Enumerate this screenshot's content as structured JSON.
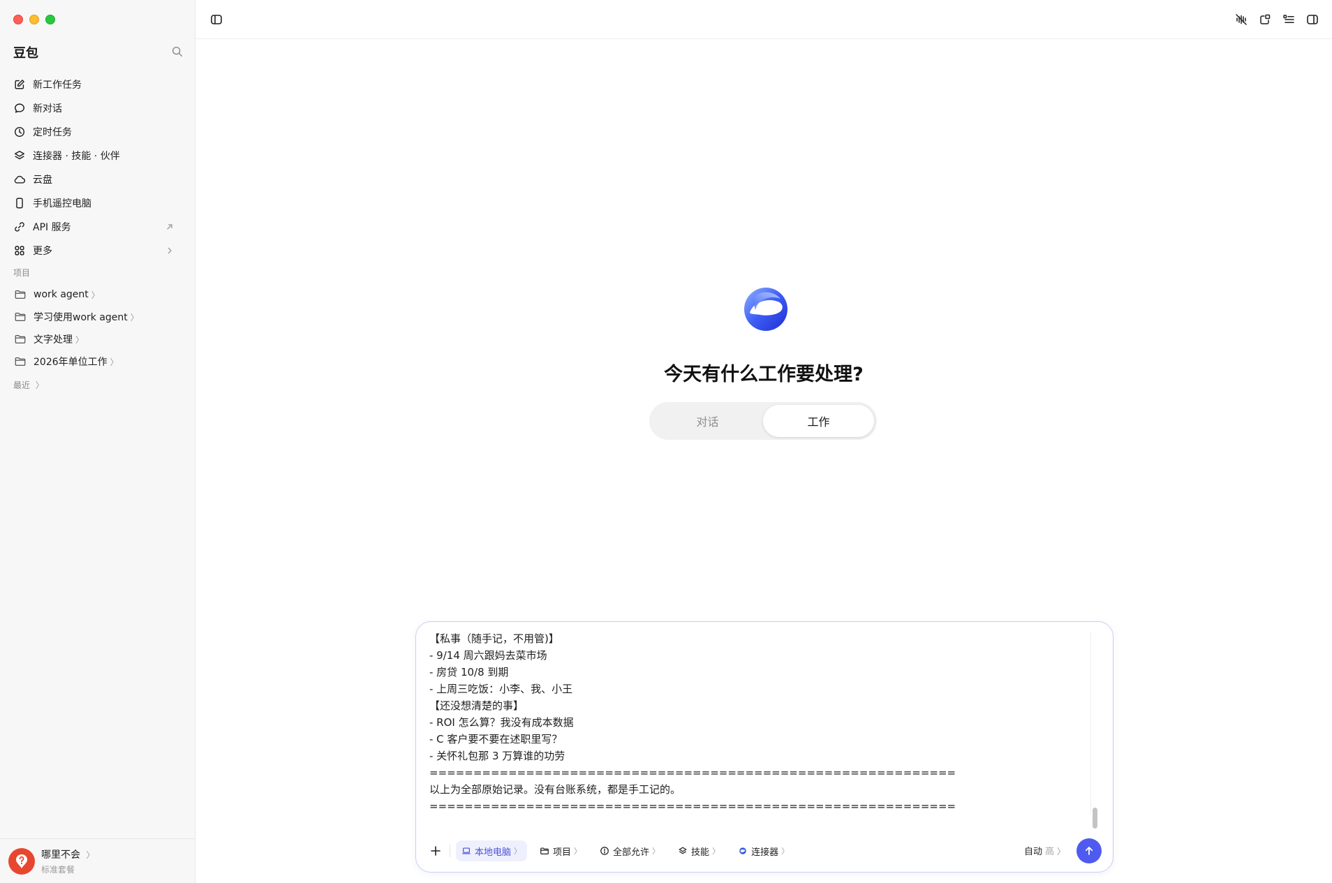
{
  "sidebar": {
    "brand": "豆包",
    "nav": [
      {
        "label": "新工作任务",
        "icon": "edit-icon"
      },
      {
        "label": "新对话",
        "icon": "chat-bubble-icon"
      },
      {
        "label": "定时任务",
        "icon": "clock-icon"
      },
      {
        "label": "连接器 · 技能 · 伙伴",
        "icon": "layers-icon"
      },
      {
        "label": "云盘",
        "icon": "cloud-icon"
      },
      {
        "label": "手机遥控电脑",
        "icon": "phone-icon"
      },
      {
        "label": "API 服务",
        "icon": "link-icon",
        "trail": "external-arrow-icon"
      },
      {
        "label": "更多",
        "icon": "grid-icon",
        "trail": "chevron-right-icon"
      }
    ],
    "projects_label": "项目",
    "projects": [
      {
        "label": "work agent",
        "chev": "〉"
      },
      {
        "label": "学习使用work agent",
        "chev": "〉"
      },
      {
        "label": "文字处理",
        "chev": "〉"
      },
      {
        "label": "2026年单位工作",
        "chev": "〉"
      }
    ],
    "recent_label": "最近",
    "recent_chev": "〉",
    "user": {
      "name": "哪里不会",
      "chev": "〉",
      "plan": "标准套餐"
    }
  },
  "main": {
    "greeting": "今天有什么工作要处理?",
    "tabs": [
      {
        "label": "对话",
        "active": false
      },
      {
        "label": "工作",
        "active": true
      }
    ]
  },
  "composer": {
    "text": "【私事（随手记，不用管)】\n- 9/14 周六跟妈去菜市场\n- 房贷 10/8 到期\n- 上周三吃饭：小李、我、小王\n【还没想清楚的事】\n- ROI 怎么算？我没有成本数据\n- C 客户要不要在述职里写？\n- 关怀礼包那 3 万算谁的功劳\n============================================================\n以上为全部原始记录。没有台账系统，都是手工记的。\n============================================================",
    "chips": [
      {
        "label": "本地电脑",
        "icon": "laptop-icon",
        "active": true,
        "chev": "〉"
      },
      {
        "label": "项目",
        "icon": "folder-icon",
        "active": false,
        "chev": "〉"
      },
      {
        "label": "全部允许",
        "icon": "alert-circle-icon",
        "active": false,
        "chev": "〉"
      },
      {
        "label": "技能",
        "icon": "layers-icon",
        "active": false,
        "chev": "〉"
      },
      {
        "label": "连接器",
        "icon": "connector-globe-icon",
        "active": false,
        "chev": "〉"
      }
    ],
    "mode": "自动",
    "level": "高",
    "level_chev": "〉"
  },
  "colors": {
    "accent": "#4f5bf0",
    "chip_active_bg": "#eef0fd",
    "composer_border": "#c9cdf5",
    "avatar_bg": "#e8472f"
  }
}
